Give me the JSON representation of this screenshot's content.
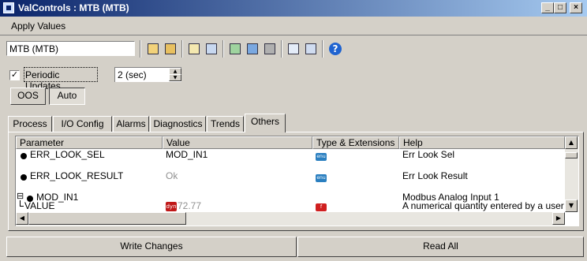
{
  "window": {
    "title": "ValControls : MTB (MTB)",
    "controls": [
      "_",
      "□",
      "×"
    ]
  },
  "menu": {
    "items": [
      "Apply Values"
    ]
  },
  "toolbar": {
    "device_value": "MTB (MTB)",
    "buttons": [
      "edit-icon",
      "edit-all-icon",
      "copy-icon",
      "paste-icon",
      "monitor-icon",
      "network-icon",
      "tree-icon",
      "list-view-icon",
      "detail-view-icon",
      "help-icon"
    ],
    "help_glyph": "?"
  },
  "options": {
    "periodic_label": "Periodic Updates",
    "periodic_checked": "✓",
    "interval_value": "2 (sec)"
  },
  "modes": {
    "oos": "OOS",
    "auto": "Auto"
  },
  "tabs": [
    "Process",
    "I/O Config",
    "Alarms",
    "Diagnostics",
    "Trends",
    "Others"
  ],
  "grid": {
    "headers": [
      "Parameter",
      "Value",
      "Type & Extensions",
      "Help"
    ],
    "rows": [
      {
        "param": "ERR_LOOK_SEL",
        "value": "MOD_IN1",
        "type_badge": "enu",
        "help": "Err Look Sel"
      },
      {
        "param": "ERR_LOOK_RESULT",
        "value": "Ok",
        "type_badge": "enu",
        "help": "Err Look Result"
      },
      {
        "param": "MOD_IN1",
        "value": "",
        "type_badge": "",
        "help": "Modbus Analog Input 1",
        "expander": "⊟"
      },
      {
        "param": "VALUE",
        "value": "72.77",
        "value_badge": "dyn",
        "type_badge": "f",
        "help": "A numerical quantity entered by a user or"
      }
    ]
  },
  "buttons": {
    "write": "Write Changes",
    "read": "Read All"
  },
  "colors": {
    "title_start": "#0a246a",
    "title_end": "#a6caf0",
    "face": "#d4d0c8",
    "enu": "#2a7fc0",
    "float": "#d02020"
  }
}
